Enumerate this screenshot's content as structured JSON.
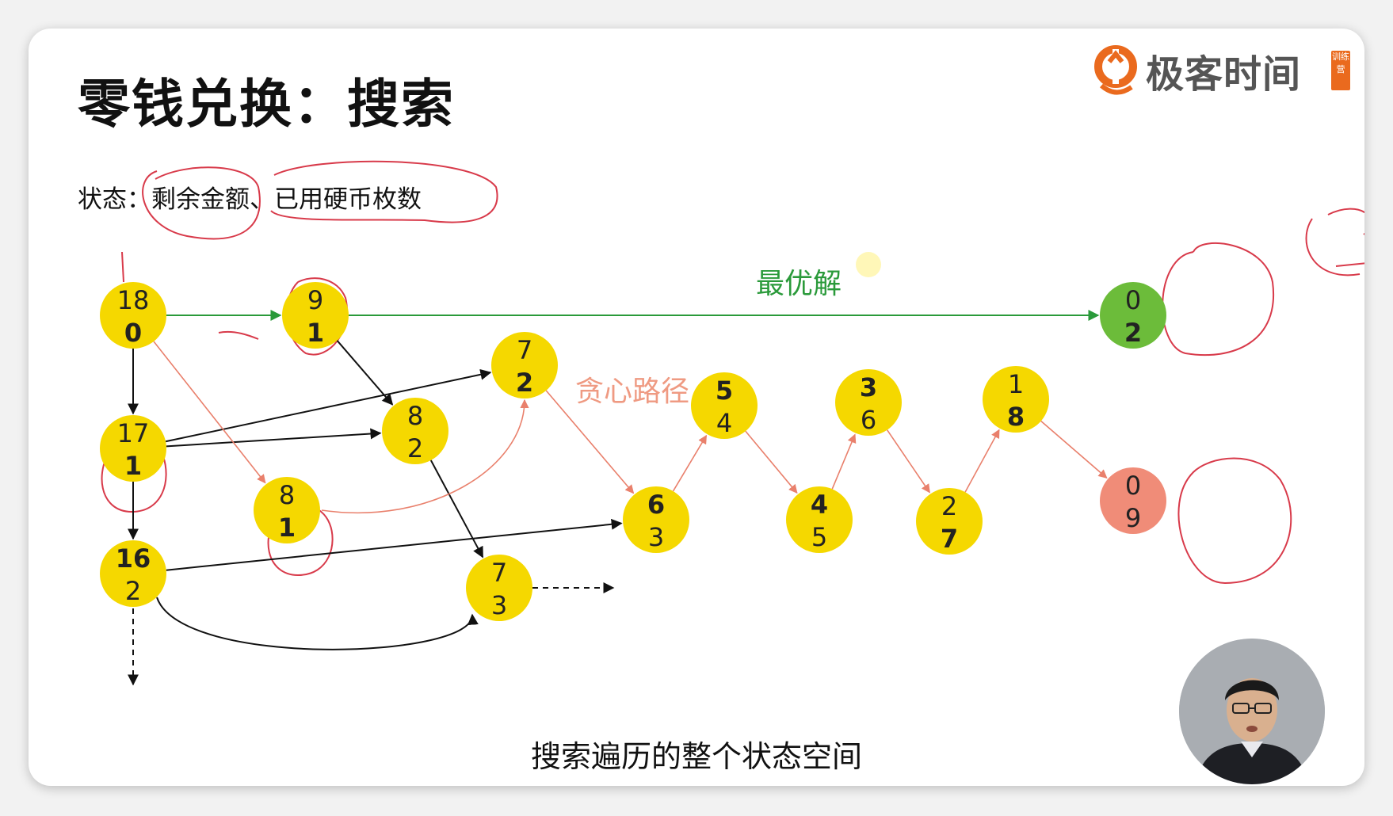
{
  "title": "零钱兑换：搜索",
  "state_label": "状态：",
  "state_items": [
    "剩余金额",
    "、",
    "已用硬币枚数"
  ],
  "logo": {
    "text": "极客时间",
    "badge": "训练营",
    "accent": "#ea6a1e"
  },
  "labels": {
    "optimal": "最优解",
    "greedy": "贪心路径"
  },
  "caption": "搜索遍历的整个状态空间",
  "colors": {
    "node_default": "#f5d800",
    "node_optimal": "#6cbc3a",
    "node_greedy_end": "#f08c78",
    "optimal_path": "#2a9a3a",
    "greedy_path": "#e9806c",
    "annotation": "#d83a4a"
  },
  "nodes": [
    {
      "id": "n18_0",
      "top": "18",
      "bottom": "0",
      "bold": "bottom",
      "kind": "default"
    },
    {
      "id": "n9_1",
      "top": "9",
      "bottom": "1",
      "bold": "bottom",
      "kind": "default"
    },
    {
      "id": "n0_2",
      "top": "0",
      "bottom": "2",
      "bold": "bottom",
      "kind": "optimal"
    },
    {
      "id": "n7_2",
      "top": "7",
      "bottom": "2",
      "bold": "bottom",
      "kind": "default"
    },
    {
      "id": "n17_1",
      "top": "17",
      "bottom": "1",
      "bold": "bottom",
      "kind": "default"
    },
    {
      "id": "n8_2",
      "top": "8",
      "bottom": "2",
      "bold": "none",
      "kind": "default"
    },
    {
      "id": "n8_1",
      "top": "8",
      "bottom": "1",
      "bold": "bottom",
      "kind": "default"
    },
    {
      "id": "n16_2",
      "top": "16",
      "bottom": "2",
      "bold": "top",
      "kind": "default"
    },
    {
      "id": "n7_3",
      "top": "7",
      "bottom": "3",
      "bold": "none",
      "kind": "default"
    },
    {
      "id": "n6_3",
      "top": "6",
      "bottom": "3",
      "bold": "top",
      "kind": "default"
    },
    {
      "id": "n5_4",
      "top": "5",
      "bottom": "4",
      "bold": "top",
      "kind": "default"
    },
    {
      "id": "n4_5",
      "top": "4",
      "bottom": "5",
      "bold": "top",
      "kind": "default"
    },
    {
      "id": "n3_6",
      "top": "3",
      "bottom": "6",
      "bold": "top",
      "kind": "default"
    },
    {
      "id": "n2_7",
      "top": "2",
      "bottom": "7",
      "bold": "bottom",
      "kind": "default"
    },
    {
      "id": "n1_8",
      "top": "1",
      "bottom": "8",
      "bold": "bottom",
      "kind": "default"
    },
    {
      "id": "n0_9",
      "top": "0",
      "bottom": "9",
      "bold": "none",
      "kind": "greedy_end"
    }
  ],
  "edges": [
    {
      "from": "n18_0",
      "to": "n9_1",
      "kind": "optimal"
    },
    {
      "from": "n9_1",
      "to": "n0_2",
      "kind": "optimal"
    },
    {
      "from": "n18_0",
      "to": "n17_1",
      "kind": "normal"
    },
    {
      "from": "n17_1",
      "to": "n16_2",
      "kind": "normal"
    },
    {
      "from": "n9_1",
      "to": "n8_2",
      "kind": "normal"
    },
    {
      "from": "n17_1",
      "to": "n7_2",
      "kind": "normal"
    },
    {
      "from": "n17_1",
      "to": "n8_2",
      "kind": "normal"
    },
    {
      "from": "n8_2",
      "to": "n7_3",
      "kind": "normal"
    },
    {
      "from": "n16_2",
      "to": "n6_3",
      "kind": "normal"
    },
    {
      "from": "n16_2",
      "to": "n7_3",
      "kind": "normal-curve"
    },
    {
      "from": "n18_0",
      "to": "n8_1",
      "kind": "greedy"
    },
    {
      "from": "n8_1",
      "to": "n7_2",
      "kind": "greedy-curve"
    },
    {
      "from": "n7_2",
      "to": "n6_3",
      "kind": "greedy"
    },
    {
      "from": "n6_3",
      "to": "n5_4",
      "kind": "greedy"
    },
    {
      "from": "n5_4",
      "to": "n4_5",
      "kind": "greedy"
    },
    {
      "from": "n4_5",
      "to": "n3_6",
      "kind": "greedy"
    },
    {
      "from": "n3_6",
      "to": "n2_7",
      "kind": "greedy"
    },
    {
      "from": "n2_7",
      "to": "n1_8",
      "kind": "greedy"
    },
    {
      "from": "n1_8",
      "to": "n0_9",
      "kind": "greedy"
    }
  ]
}
